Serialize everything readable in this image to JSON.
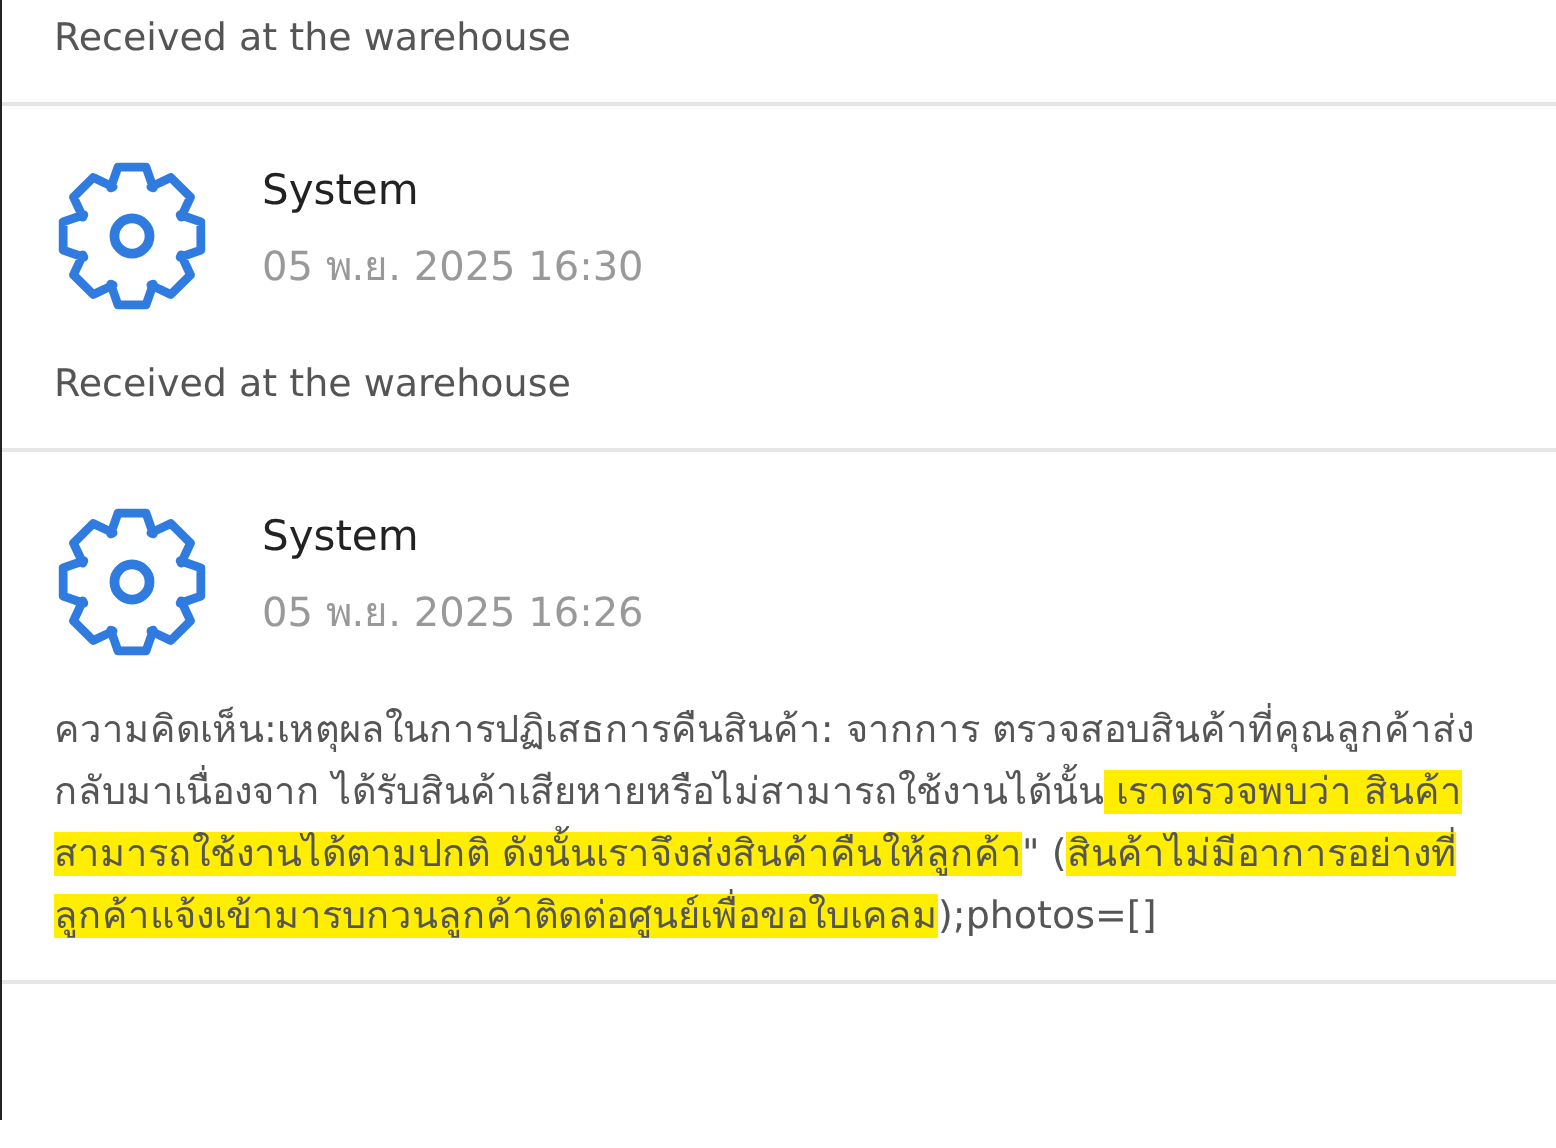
{
  "entries": [
    {
      "message": [
        {
          "text": "Received at the warehouse",
          "highlighted": false
        }
      ]
    },
    {
      "author": "System",
      "time": "05 พ.ย. 2025 16:30",
      "message": [
        {
          "text": "Received at the warehouse",
          "highlighted": false
        }
      ]
    },
    {
      "author": "System",
      "time": "05 พ.ย. 2025 16:26",
      "message": [
        {
          "text": "ความคิดเห็น:เหตุผลในการปฏิเสธการคืนสินค้า: จากการ ตรวจสอบสินค้าที่คุณลูกค้าส่งกลับมาเนื่องจาก ได้รับสินค้าเสียหายหรือไม่สามารถใช้งานได้นั้น",
          "highlighted": false
        },
        {
          "text": " เราตรวจพบว่า สินค้าสามารถใช้งานได้ตามปกติ ดังนั้นเราจึงส่งสินค้าคืนให้ลูกค้า",
          "highlighted": true
        },
        {
          "text": "\" (",
          "highlighted": false
        },
        {
          "text": "สินค้าไม่มีอาการอย่างที่ลูกค้าแจ้งเข้ามารบกวนลูกค้าติดต่อศูนย์เพื่อขอใบเคลม",
          "highlighted": true
        },
        {
          "text": ");photos=[]",
          "highlighted": false
        }
      ]
    }
  ]
}
